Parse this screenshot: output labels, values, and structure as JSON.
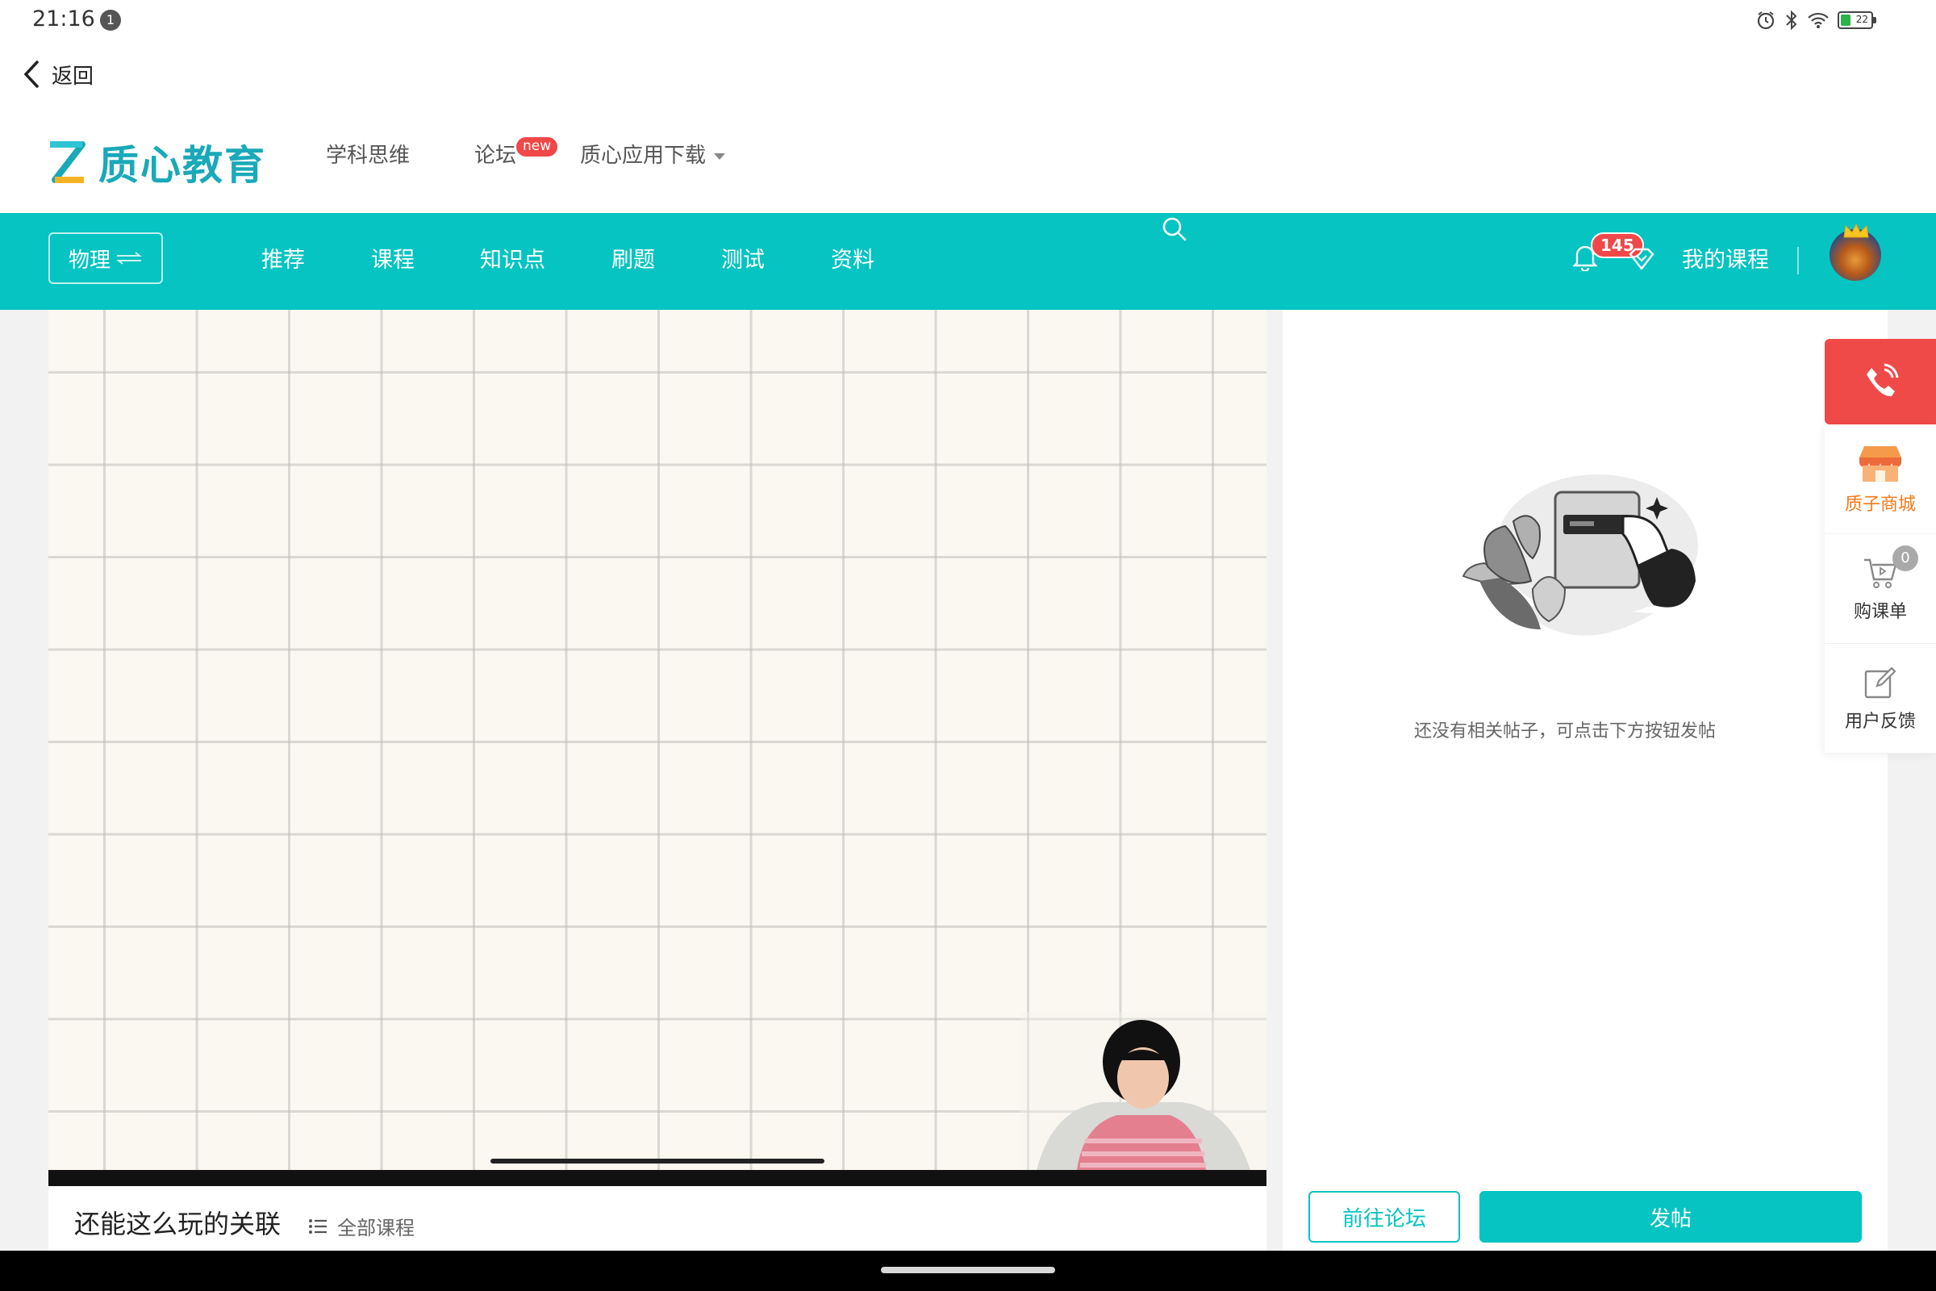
{
  "status": {
    "time": "21:16",
    "notification_count": "1",
    "battery": "22"
  },
  "back": {
    "label": "返回"
  },
  "brand": {
    "name": "质心教育",
    "color": "#1aa9b8"
  },
  "top_nav": {
    "subject_thinking": "学科思维",
    "forum": "论坛",
    "forum_badge": "new",
    "app_download": "质心应用下载"
  },
  "main_nav": {
    "subject": "物理",
    "items": [
      "推荐",
      "课程",
      "知识点",
      "刷题",
      "测试",
      "资料"
    ],
    "notification_count": "145",
    "my_courses": "我的课程",
    "accent": "#05c4c2"
  },
  "course": {
    "title": "还能这么玩的关联",
    "all_courses": "全部课程"
  },
  "forum_panel": {
    "empty_message": "还没有相关帖子，可点击下方按钮发帖",
    "goto_forum": "前往论坛",
    "post": "发帖"
  },
  "float_sidebar": {
    "shop": "质子商城",
    "cart": "购课单",
    "cart_count": "0",
    "feedback": "用户反馈"
  }
}
